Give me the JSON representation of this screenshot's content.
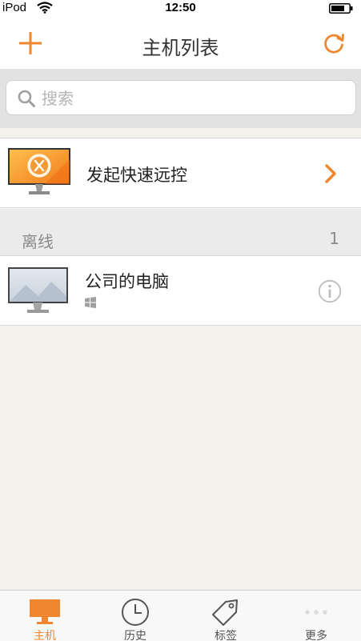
{
  "status_bar": {
    "carrier": "iPod",
    "time": "12:50"
  },
  "nav": {
    "title": "主机列表",
    "add_icon": "plus-icon",
    "refresh_icon": "refresh-icon"
  },
  "search": {
    "placeholder": "搜索",
    "value": ""
  },
  "quick_remote": {
    "label": "发起快速远控"
  },
  "section": {
    "name": "离线",
    "count": "1"
  },
  "host": {
    "name": "公司的电脑",
    "os_icon": "windows-icon"
  },
  "tabs": [
    {
      "label": "主机",
      "icon": "monitor-icon",
      "active": true
    },
    {
      "label": "历史",
      "icon": "clock-icon",
      "active": false
    },
    {
      "label": "标签",
      "icon": "tag-icon",
      "active": false
    },
    {
      "label": "更多",
      "icon": "more-icon",
      "active": false
    }
  ],
  "colors": {
    "accent": "#f0862d",
    "background": "#f4f1ed"
  }
}
